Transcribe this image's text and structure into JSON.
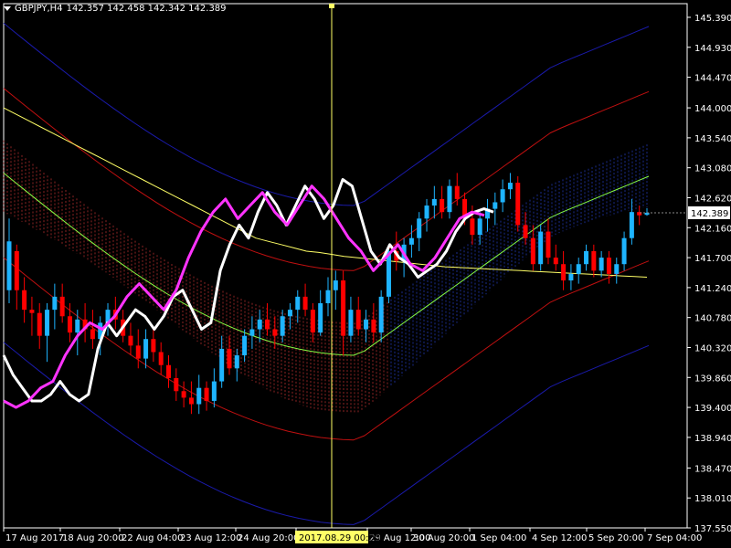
{
  "header": {
    "symbol": "GBPJPY,H4",
    "ohlc": "142.357 142.458 142.342 142.389"
  },
  "price_tag": "142.389",
  "crosshair": {
    "time_label": "2017.08.29 00:00"
  },
  "icons": {
    "menu": "chevron-down-icon"
  },
  "colors": {
    "background": "#000000",
    "axis": "#ffffff",
    "bull": "#1eb4ff",
    "bear": "#ff0000",
    "ma": "#ffff66",
    "white_line": "#ffffff",
    "magenta_line": "#ff33ff",
    "bb_outer": "#1a1aaa",
    "bb_mid": "#c01010",
    "bb_center": "#88ff44",
    "cloud": "#ff4040",
    "crosshair": "#ffff66"
  },
  "chart_data": {
    "type": "candlestick",
    "instrument": "GBPJPY",
    "timeframe": "H4",
    "ylim": [
      137.55,
      145.6
    ],
    "y_ticks": [
      "145.390",
      "144.930",
      "144.470",
      "144.000",
      "143.540",
      "143.080",
      "142.620",
      "142.160",
      "141.700",
      "141.240",
      "140.780",
      "140.320",
      "139.860",
      "139.400",
      "138.940",
      "138.470",
      "138.010",
      "137.550"
    ],
    "x_ticks": [
      "17 Aug 2017",
      "18 Aug 20:00",
      "22 Aug 04:00",
      "23 Aug 12:00",
      "24 Aug 20:00",
      "28 Aug 04:00",
      "29 Aug 12:00",
      "30 Aug 20:00",
      "1 Sep 04:00",
      "4 Sep 12:00",
      "5 Sep 20:00",
      "7 Sep 04:00"
    ],
    "current_price": 142.389,
    "candles": [
      {
        "o": 141.2,
        "h": 142.3,
        "l": 141.0,
        "c": 141.95
      },
      {
        "o": 141.8,
        "h": 141.9,
        "l": 140.9,
        "c": 141.2
      },
      {
        "o": 141.2,
        "h": 141.4,
        "l": 140.7,
        "c": 140.9
      },
      {
        "o": 140.9,
        "h": 141.1,
        "l": 140.5,
        "c": 140.85
      },
      {
        "o": 140.85,
        "h": 141.0,
        "l": 140.3,
        "c": 140.5
      },
      {
        "o": 140.5,
        "h": 141.0,
        "l": 140.1,
        "c": 140.9
      },
      {
        "o": 140.9,
        "h": 141.3,
        "l": 140.6,
        "c": 141.1
      },
      {
        "o": 141.1,
        "h": 141.3,
        "l": 140.7,
        "c": 140.8
      },
      {
        "o": 140.8,
        "h": 141.0,
        "l": 140.4,
        "c": 140.55
      },
      {
        "o": 140.55,
        "h": 140.9,
        "l": 140.2,
        "c": 140.75
      },
      {
        "o": 140.75,
        "h": 141.0,
        "l": 140.4,
        "c": 140.6
      },
      {
        "o": 140.6,
        "h": 140.9,
        "l": 140.3,
        "c": 140.45
      },
      {
        "o": 140.45,
        "h": 140.8,
        "l": 140.2,
        "c": 140.7
      },
      {
        "o": 140.7,
        "h": 141.0,
        "l": 140.5,
        "c": 140.9
      },
      {
        "o": 140.9,
        "h": 141.1,
        "l": 140.6,
        "c": 140.75
      },
      {
        "o": 140.75,
        "h": 140.9,
        "l": 140.4,
        "c": 140.5
      },
      {
        "o": 140.5,
        "h": 140.7,
        "l": 140.2,
        "c": 140.35
      },
      {
        "o": 140.35,
        "h": 140.6,
        "l": 140.0,
        "c": 140.15
      },
      {
        "o": 140.15,
        "h": 140.6,
        "l": 140.0,
        "c": 140.45
      },
      {
        "o": 140.45,
        "h": 140.6,
        "l": 140.1,
        "c": 140.25
      },
      {
        "o": 140.25,
        "h": 140.4,
        "l": 139.9,
        "c": 140.05
      },
      {
        "o": 140.05,
        "h": 140.2,
        "l": 139.7,
        "c": 139.85
      },
      {
        "o": 139.85,
        "h": 140.0,
        "l": 139.5,
        "c": 139.65
      },
      {
        "o": 139.65,
        "h": 139.8,
        "l": 139.4,
        "c": 139.55
      },
      {
        "o": 139.55,
        "h": 139.8,
        "l": 139.3,
        "c": 139.45
      },
      {
        "o": 139.45,
        "h": 139.9,
        "l": 139.3,
        "c": 139.7
      },
      {
        "o": 139.7,
        "h": 139.8,
        "l": 139.35,
        "c": 139.5
      },
      {
        "o": 139.5,
        "h": 140.0,
        "l": 139.4,
        "c": 139.8
      },
      {
        "o": 139.8,
        "h": 140.5,
        "l": 139.7,
        "c": 140.3
      },
      {
        "o": 140.3,
        "h": 140.5,
        "l": 139.9,
        "c": 140.0
      },
      {
        "o": 140.0,
        "h": 140.3,
        "l": 139.8,
        "c": 140.2
      },
      {
        "o": 140.2,
        "h": 140.6,
        "l": 140.1,
        "c": 140.5
      },
      {
        "o": 140.5,
        "h": 140.8,
        "l": 140.3,
        "c": 140.6
      },
      {
        "o": 140.6,
        "h": 140.9,
        "l": 140.4,
        "c": 140.75
      },
      {
        "o": 140.75,
        "h": 141.0,
        "l": 140.5,
        "c": 140.6
      },
      {
        "o": 140.6,
        "h": 140.8,
        "l": 140.3,
        "c": 140.5
      },
      {
        "o": 140.5,
        "h": 140.9,
        "l": 140.4,
        "c": 140.8
      },
      {
        "o": 140.8,
        "h": 141.0,
        "l": 140.6,
        "c": 140.9
      },
      {
        "o": 140.9,
        "h": 141.2,
        "l": 140.7,
        "c": 141.1
      },
      {
        "o": 141.1,
        "h": 141.3,
        "l": 140.8,
        "c": 140.9
      },
      {
        "o": 140.9,
        "h": 141.0,
        "l": 140.4,
        "c": 140.55
      },
      {
        "o": 140.55,
        "h": 141.2,
        "l": 140.5,
        "c": 141.0
      },
      {
        "o": 141.0,
        "h": 141.4,
        "l": 140.8,
        "c": 141.2
      },
      {
        "o": 141.2,
        "h": 141.5,
        "l": 140.9,
        "c": 141.35
      },
      {
        "o": 141.35,
        "h": 141.5,
        "l": 140.2,
        "c": 140.5
      },
      {
        "o": 140.5,
        "h": 141.1,
        "l": 140.4,
        "c": 140.9
      },
      {
        "o": 140.9,
        "h": 141.1,
        "l": 140.5,
        "c": 140.6
      },
      {
        "o": 140.6,
        "h": 140.9,
        "l": 140.4,
        "c": 140.75
      },
      {
        "o": 140.75,
        "h": 141.0,
        "l": 140.4,
        "c": 140.55
      },
      {
        "o": 140.55,
        "h": 141.2,
        "l": 140.4,
        "c": 141.1
      },
      {
        "o": 141.1,
        "h": 141.9,
        "l": 141.0,
        "c": 141.8
      },
      {
        "o": 141.8,
        "h": 142.1,
        "l": 141.5,
        "c": 141.65
      },
      {
        "o": 141.65,
        "h": 142.0,
        "l": 141.4,
        "c": 141.9
      },
      {
        "o": 141.9,
        "h": 142.2,
        "l": 141.7,
        "c": 142.0
      },
      {
        "o": 142.0,
        "h": 142.4,
        "l": 141.8,
        "c": 142.3
      },
      {
        "o": 142.3,
        "h": 142.6,
        "l": 142.1,
        "c": 142.5
      },
      {
        "o": 142.5,
        "h": 142.8,
        "l": 142.3,
        "c": 142.6
      },
      {
        "o": 142.6,
        "h": 142.8,
        "l": 142.3,
        "c": 142.4
      },
      {
        "o": 142.4,
        "h": 142.9,
        "l": 142.3,
        "c": 142.8
      },
      {
        "o": 142.8,
        "h": 143.0,
        "l": 142.5,
        "c": 142.6
      },
      {
        "o": 142.6,
        "h": 142.7,
        "l": 142.2,
        "c": 142.3
      },
      {
        "o": 142.3,
        "h": 142.5,
        "l": 141.9,
        "c": 142.05
      },
      {
        "o": 142.05,
        "h": 142.4,
        "l": 141.9,
        "c": 142.3
      },
      {
        "o": 142.3,
        "h": 142.6,
        "l": 142.1,
        "c": 142.45
      },
      {
        "o": 142.45,
        "h": 142.7,
        "l": 142.2,
        "c": 142.55
      },
      {
        "o": 142.55,
        "h": 142.9,
        "l": 142.4,
        "c": 142.75
      },
      {
        "o": 142.75,
        "h": 143.0,
        "l": 142.6,
        "c": 142.85
      },
      {
        "o": 142.85,
        "h": 142.95,
        "l": 142.1,
        "c": 142.2
      },
      {
        "o": 142.2,
        "h": 142.4,
        "l": 141.9,
        "c": 142.0
      },
      {
        "o": 142.0,
        "h": 142.2,
        "l": 141.5,
        "c": 141.6
      },
      {
        "o": 141.6,
        "h": 142.2,
        "l": 141.5,
        "c": 142.1
      },
      {
        "o": 142.1,
        "h": 142.3,
        "l": 141.6,
        "c": 141.7
      },
      {
        "o": 141.7,
        "h": 141.9,
        "l": 141.5,
        "c": 141.6
      },
      {
        "o": 141.6,
        "h": 141.8,
        "l": 141.2,
        "c": 141.35
      },
      {
        "o": 141.35,
        "h": 141.6,
        "l": 141.2,
        "c": 141.45
      },
      {
        "o": 141.45,
        "h": 141.7,
        "l": 141.3,
        "c": 141.6
      },
      {
        "o": 141.6,
        "h": 141.9,
        "l": 141.5,
        "c": 141.8
      },
      {
        "o": 141.8,
        "h": 141.9,
        "l": 141.4,
        "c": 141.5
      },
      {
        "o": 141.5,
        "h": 141.8,
        "l": 141.4,
        "c": 141.7
      },
      {
        "o": 141.7,
        "h": 141.8,
        "l": 141.3,
        "c": 141.45
      },
      {
        "o": 141.45,
        "h": 141.7,
        "l": 141.3,
        "c": 141.6
      },
      {
        "o": 141.6,
        "h": 142.1,
        "l": 141.5,
        "c": 142.0
      },
      {
        "o": 142.0,
        "h": 142.6,
        "l": 141.9,
        "c": 142.4
      },
      {
        "o": 142.4,
        "h": 142.5,
        "l": 142.2,
        "c": 142.35
      },
      {
        "o": 142.357,
        "h": 142.458,
        "l": 142.342,
        "c": 142.389
      }
    ],
    "ma_slow": [
      144.0,
      143.9,
      143.8,
      143.7,
      143.6,
      143.5,
      143.4,
      143.3,
      143.2,
      143.1,
      143.0,
      142.9,
      142.8,
      142.7,
      142.6,
      142.5,
      142.4,
      142.3,
      142.2,
      142.1,
      142.0,
      141.95,
      141.9,
      141.85,
      141.8,
      141.78,
      141.75,
      141.72,
      141.7,
      141.68,
      141.66,
      141.64,
      141.62,
      141.6,
      141.58,
      141.56,
      141.55,
      141.54,
      141.53,
      141.52,
      141.51,
      141.5,
      141.49,
      141.48,
      141.47,
      141.46,
      141.45,
      141.44,
      141.43,
      141.42,
      141.41,
      141.4
    ],
    "white_line": [
      140.2,
      139.9,
      139.7,
      139.5,
      139.5,
      139.6,
      139.8,
      139.6,
      139.5,
      139.6,
      140.3,
      140.7,
      140.5,
      140.7,
      140.9,
      140.8,
      140.6,
      140.8,
      141.1,
      141.2,
      140.9,
      140.6,
      140.7,
      141.5,
      141.9,
      142.2,
      142.0,
      142.4,
      142.7,
      142.5,
      142.2,
      142.5,
      142.8,
      142.6,
      142.3,
      142.5,
      142.9,
      142.8,
      142.3,
      141.8,
      141.6,
      141.9,
      141.7,
      141.6,
      141.4,
      141.5,
      141.6,
      141.8,
      142.1,
      142.3,
      142.4,
      142.45,
      142.4
    ],
    "magenta_line": [
      139.5,
      139.4,
      139.5,
      139.7,
      139.8,
      140.2,
      140.5,
      140.7,
      140.6,
      140.8,
      141.1,
      141.3,
      141.1,
      140.9,
      141.2,
      141.7,
      142.1,
      142.4,
      142.6,
      142.3,
      142.5,
      142.7,
      142.4,
      142.2,
      142.5,
      142.8,
      142.6,
      142.3,
      142.0,
      141.8,
      141.5,
      141.7,
      141.9,
      141.6,
      141.5,
      141.7,
      142.0,
      142.3,
      142.4,
      142.35
    ]
  }
}
